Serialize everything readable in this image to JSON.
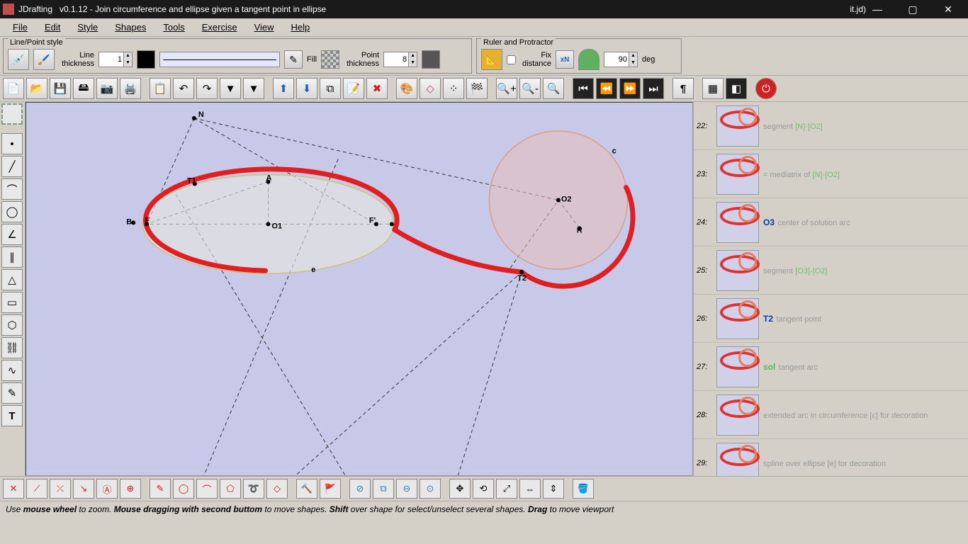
{
  "titlebar": {
    "app": "JDrafting",
    "version": "v0.1.12",
    "doc": "Join circumference and ellipse  given a tangent point in ellipse",
    "filename": "it.jd)"
  },
  "menu": [
    "File",
    "Edit",
    "Style",
    "Shapes",
    "Tools",
    "Exercise",
    "View",
    "Help"
  ],
  "panels": {
    "linepoint": {
      "title": "Line/Point style",
      "line_thickness_label": "Line\nthickness",
      "line_thickness_value": "1",
      "fill_label": "Fill",
      "point_thickness_label": "Point\nthickness",
      "point_thickness_value": "8"
    },
    "ruler": {
      "title": "Ruler and Protractor",
      "fix_distance_label": "Fix\ndistance",
      "xn_label": "xN",
      "angle_value": "90",
      "deg_label": "deg"
    }
  },
  "canvas": {
    "points": {
      "N": "N",
      "A": "A",
      "T1": "T1",
      "B": "B",
      "F": "F",
      "O1": "O1",
      "Fp": "F'",
      "O2": "O2",
      "R": "R",
      "T2": "T2",
      "c": "c",
      "e": "e"
    }
  },
  "history": [
    {
      "num": "22:",
      "name": "",
      "desc": "segment",
      "extra": "[N]-[O2]",
      "color": "green"
    },
    {
      "num": "23:",
      "name": "",
      "desc": "= mediatrix of",
      "extra": "[N]-[O2]",
      "color": "green"
    },
    {
      "num": "24:",
      "name": "O3",
      "desc": "center of solution arc",
      "color": "blue"
    },
    {
      "num": "25:",
      "name": "",
      "desc": "segment",
      "extra": "[O3]-[O2]",
      "color": "green"
    },
    {
      "num": "26:",
      "name": "T2",
      "desc": "tangent point",
      "color": "blue"
    },
    {
      "num": "27:",
      "name": "sol",
      "desc": "tangent arc",
      "color": "green2"
    },
    {
      "num": "28:",
      "name": "",
      "desc": "extended arc in circumference [c] for decoration",
      "color": "gray"
    },
    {
      "num": "29:",
      "name": "",
      "desc": "spline over ellipse [e] for decoration",
      "color": "gray"
    }
  ],
  "statusbar": {
    "text1": "Use ",
    "b1": "mouse wheel",
    "text2": " to zoom. ",
    "b2": "Mouse dragging with second buttom",
    "text3": " to move shapes. ",
    "b3": "Shift",
    "text4": " over shape for select/unselect several shapes. ",
    "b4": "Drag",
    "text5": " to move viewport"
  },
  "colors": {
    "accent_red": "#e02020",
    "canvas_bg": "#c8c8e8"
  }
}
